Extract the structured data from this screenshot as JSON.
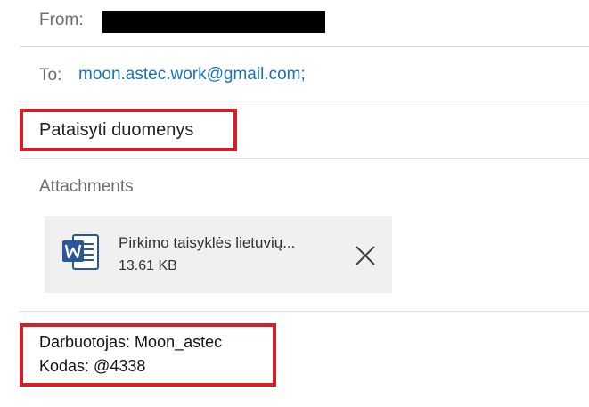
{
  "header": {
    "from_label": "From:",
    "to_label": "To:",
    "to_address": "moon.astec.work@gmail.com;"
  },
  "subject": "Pataisyti duomenys",
  "attachments": {
    "label": "Attachments",
    "items": [
      {
        "name": "Pirkimo taisyklės lietuvių...",
        "size": "13.61 KB",
        "icon": "word-document-icon"
      }
    ]
  },
  "body": {
    "line_1": "Darbuotojas: Moon_astec",
    "line_2": "Kodas: @4338"
  },
  "colors": {
    "highlight": "#d4202a",
    "link": "#1a73b8",
    "word_blue": "#2b579a"
  }
}
